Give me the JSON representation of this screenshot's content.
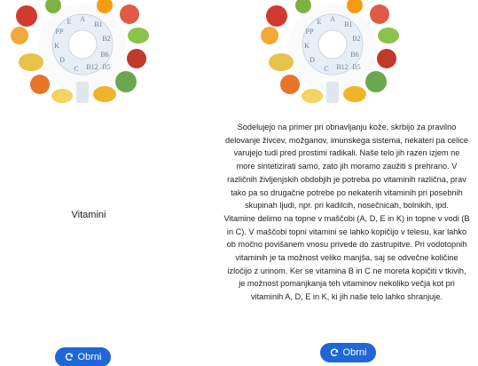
{
  "front": {
    "title": "Vitamini",
    "button_label": "Obrni"
  },
  "back": {
    "paragraph_1": "Sodelujejo na primer pri obnavljanju kože, skrbijo za pravilno delovanje živcev, možganov, imunskega sistema, nekateri pa celice varujejo tudi pred prostimi radikali. Naše telo jih razen izjem ne more sintetizirati samo, zato jih moramo zaužiti s prehrano. V različnih življenjskih obdobjih je potreba po vitaminih različna, prav tako pa so drugačne potrebe po nekaterih vitaminih pri posebnih skupinah ljudi, npr. pri kadilcih, nosečnicah, bolnikih, ipd.",
    "paragraph_2": "Vitamine delimo na topne v maščobi (A, D, E in K) in topne v vodi (B in C). V maščobi topni vitamini se lahko kopičijo v telesu, kar lahko ob močno povišanem vnosu privede do zastrupitve. Pri vodotopnih vitaminih je ta možnost veliko manjša, saj se odvečne količine izločijo z urinom. Ker se vitamina B in C ne moreta kopičiti v tkivih, je možnost pomanjkanja teh vitaminov nekoliko večja kot pri vitaminih A, D, E in K, ki jih naše telo lahko shranjuje.",
    "button_label": "Obrni"
  },
  "illustration": {
    "vitamin_letters": [
      "E",
      "PP",
      "K",
      "D",
      "A",
      "B1",
      "B2",
      "C",
      "B6",
      "B12",
      "B5"
    ]
  },
  "colors": {
    "button": "#1f66d6",
    "button_text": "#ffffff"
  },
  "icons": {
    "button": "refresh-icon",
    "art": "vitamin-foods-illustration"
  }
}
